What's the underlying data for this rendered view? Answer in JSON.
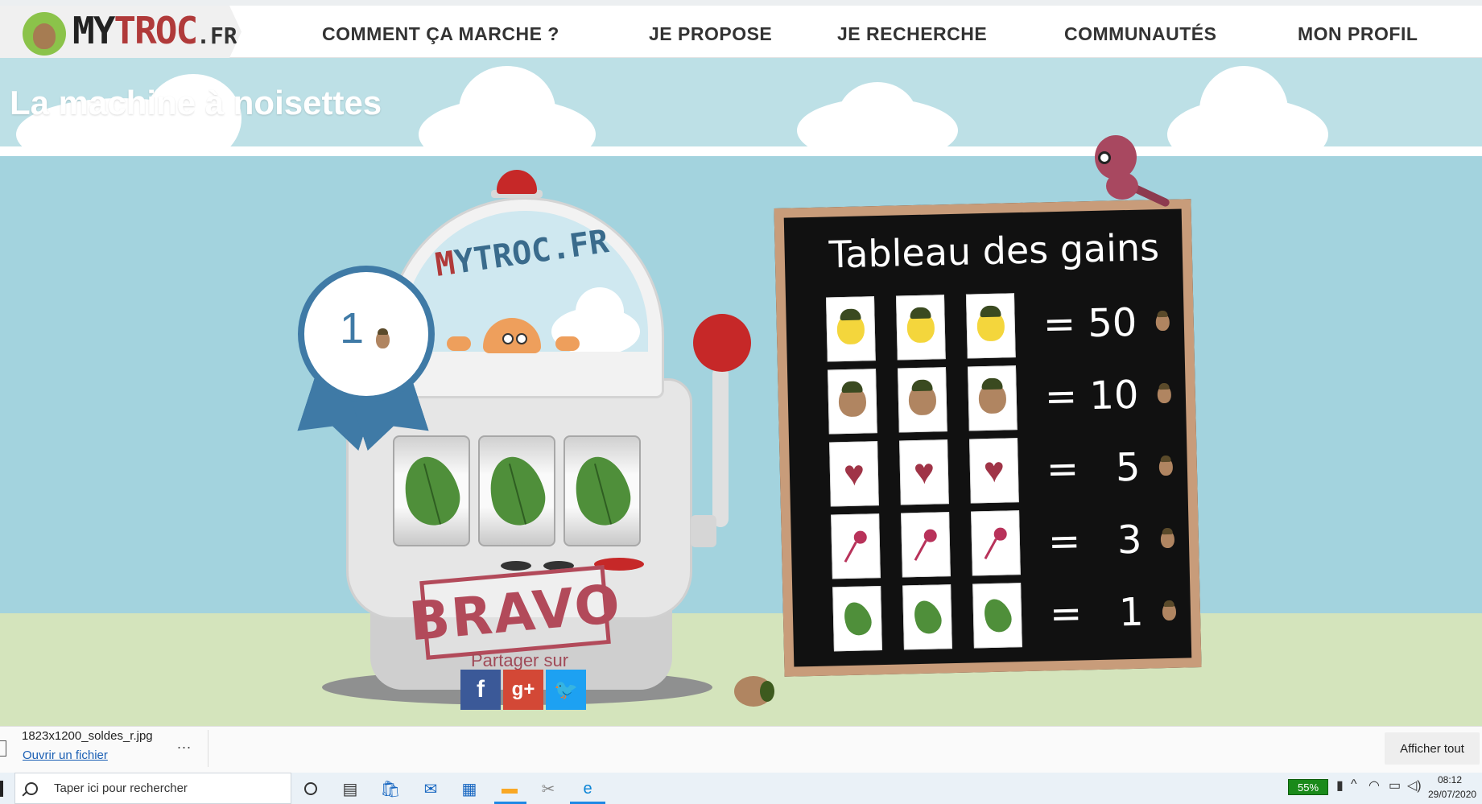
{
  "header": {
    "logo": {
      "part1": "MY",
      "part2": "TROC",
      "part3": ".FR"
    },
    "nav": [
      {
        "label": "COMMENT ÇA MARCHE ?"
      },
      {
        "label": "JE PROPOSE"
      },
      {
        "label": "JE RECHERCHE"
      },
      {
        "label": "COMMUNAUTÉS"
      },
      {
        "label": "MON PROFIL"
      }
    ]
  },
  "banner": {
    "title": "La machine à noisettes"
  },
  "machine": {
    "brand_m": "M",
    "brand_rest": "YTROC.FR",
    "reels": [
      "leaf-icon",
      "leaf-icon",
      "leaf-icon"
    ],
    "result_stamp": "BRAVO",
    "share_label": "Partager sur",
    "share": [
      {
        "icon": "facebook-icon",
        "glyph": "f",
        "color": "#3b5998"
      },
      {
        "icon": "google-plus-icon",
        "glyph": "g+",
        "color": "#d34836"
      },
      {
        "icon": "twitter-icon",
        "glyph": "🐦",
        "color": "#1da1f2"
      }
    ]
  },
  "badge": {
    "value": "1"
  },
  "board": {
    "title": "Tableau des gains",
    "rows": [
      {
        "symbol": "yellow-acorn",
        "result": "= 50"
      },
      {
        "symbol": "brown-acorn",
        "result": "= 10"
      },
      {
        "symbol": "heart",
        "result": "=   5"
      },
      {
        "symbol": "pin",
        "result": "=   3"
      },
      {
        "symbol": "leaf",
        "result": "=   1"
      }
    ]
  },
  "download": {
    "file_name": "1823x1200_soldes_r.jpg",
    "open_label": "Ouvrir un fichier",
    "more_label": "...",
    "show_all_label": "Afficher tout"
  },
  "taskbar": {
    "search_placeholder": "Taper ici pour rechercher",
    "battery": "55%",
    "time": "08:12",
    "date": "29/07/2020"
  },
  "colors": {
    "sky": "#a3d3de",
    "ground": "#d4e4bc",
    "accent_red": "#b03a3a",
    "badge_blue": "#3f7aa6"
  }
}
